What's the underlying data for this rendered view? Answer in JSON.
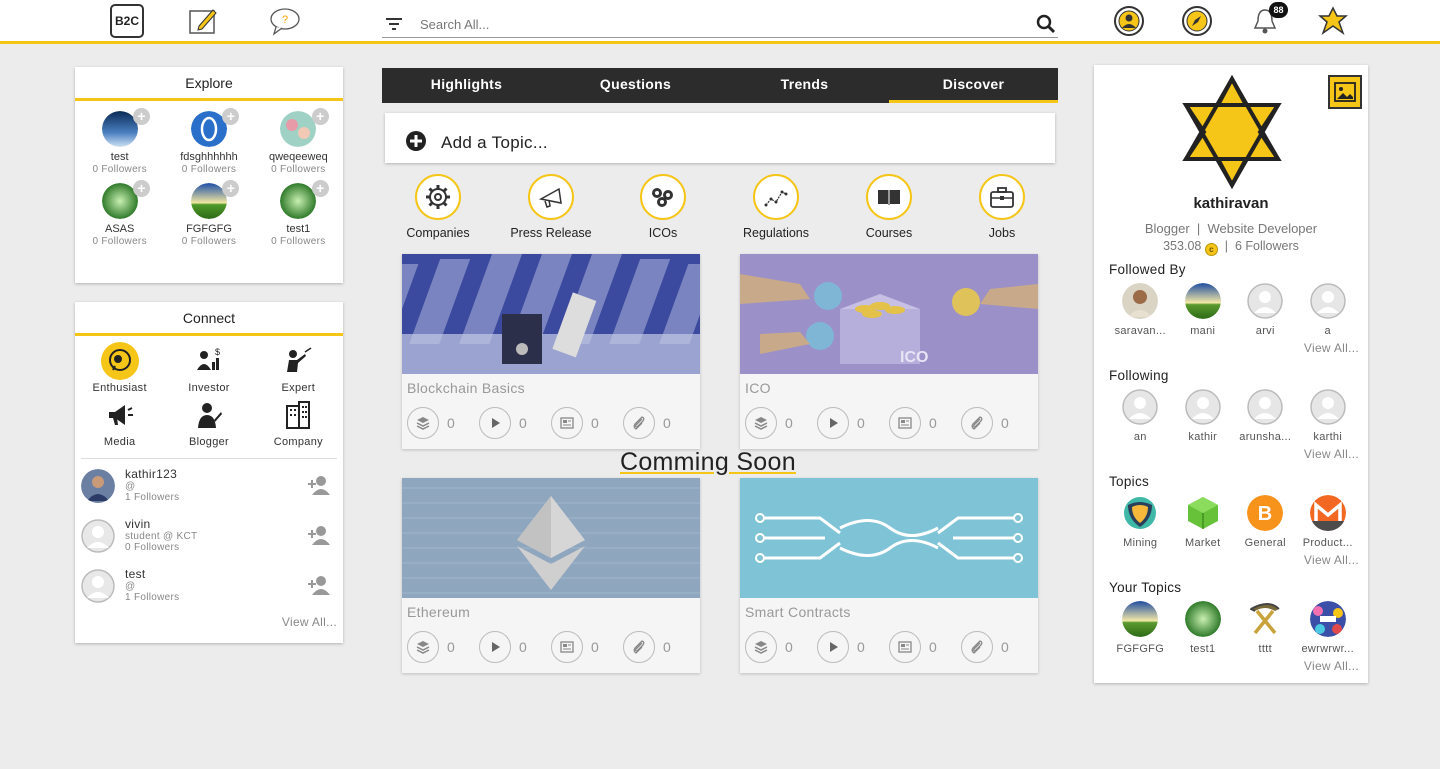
{
  "topbar": {
    "logo": "B2C",
    "icons": [
      "logo-icon",
      "edit-icon",
      "question-bubble-icon",
      "profile-icon",
      "compass-icon",
      "bell-icon",
      "star-icon"
    ],
    "search_placeholder": "Search All...",
    "notification_count": "88",
    "accent": "#f5c518"
  },
  "explore": {
    "title": "Explore",
    "items": [
      {
        "name": "test",
        "followers": "0 Followers"
      },
      {
        "name": "fdsghhhhhh",
        "followers": "0 Followers"
      },
      {
        "name": "qweqeeweq",
        "followers": "0 Followers"
      },
      {
        "name": "ASAS",
        "followers": "0 Followers"
      },
      {
        "name": "FGFGFG",
        "followers": "0 Followers"
      },
      {
        "name": "test1",
        "followers": "0 Followers"
      }
    ]
  },
  "connect": {
    "title": "Connect",
    "roles": [
      "Enthusiast",
      "Investor",
      "Expert",
      "Media",
      "Blogger",
      "Company"
    ],
    "users": [
      {
        "name": "kathir123",
        "sub": "@",
        "followers": "1 Followers"
      },
      {
        "name": "vivin",
        "sub": "student @ KCT",
        "followers": "0 Followers"
      },
      {
        "name": "test",
        "sub": "@",
        "followers": "1 Followers"
      }
    ],
    "view_all": "View All..."
  },
  "tabs": [
    "Highlights",
    "Questions",
    "Trends",
    "Discover"
  ],
  "add_topic": "Add a Topic...",
  "categories": [
    "Companies",
    "Press Release",
    "ICOs",
    "Regulations",
    "Courses",
    "Jobs"
  ],
  "cards": [
    {
      "title": "Blockchain Basics",
      "stats": [
        "0",
        "0",
        "0",
        "0"
      ]
    },
    {
      "title": "ICO",
      "stats": [
        "0",
        "0",
        "0",
        "0"
      ]
    },
    {
      "title": "Ethereum",
      "stats": [
        "0",
        "0",
        "0",
        "0"
      ]
    },
    {
      "title": "Smart Contracts",
      "stats": [
        "0",
        "0",
        "0",
        "0"
      ]
    }
  ],
  "comming_soon": "Comming Soon",
  "profile": {
    "name": "kathiravan",
    "role": "Blogger  |  Website Developer",
    "points": "353.08",
    "followers": "6 Followers",
    "followed_by": {
      "title": "Followed By",
      "items": [
        "saravan...",
        "mani",
        "arvi",
        "a"
      ]
    },
    "following": {
      "title": "Following",
      "items": [
        "an",
        "kathir",
        "arunsha...",
        "karthi"
      ]
    },
    "topics": {
      "title": "Topics",
      "items": [
        "Mining",
        "Market",
        "General",
        "Product..."
      ]
    },
    "your_topics": {
      "title": "Your Topics",
      "items": [
        "FGFGFG",
        "test1",
        "tttt",
        "ewrwrwr..."
      ]
    },
    "view_all": "View All..."
  }
}
